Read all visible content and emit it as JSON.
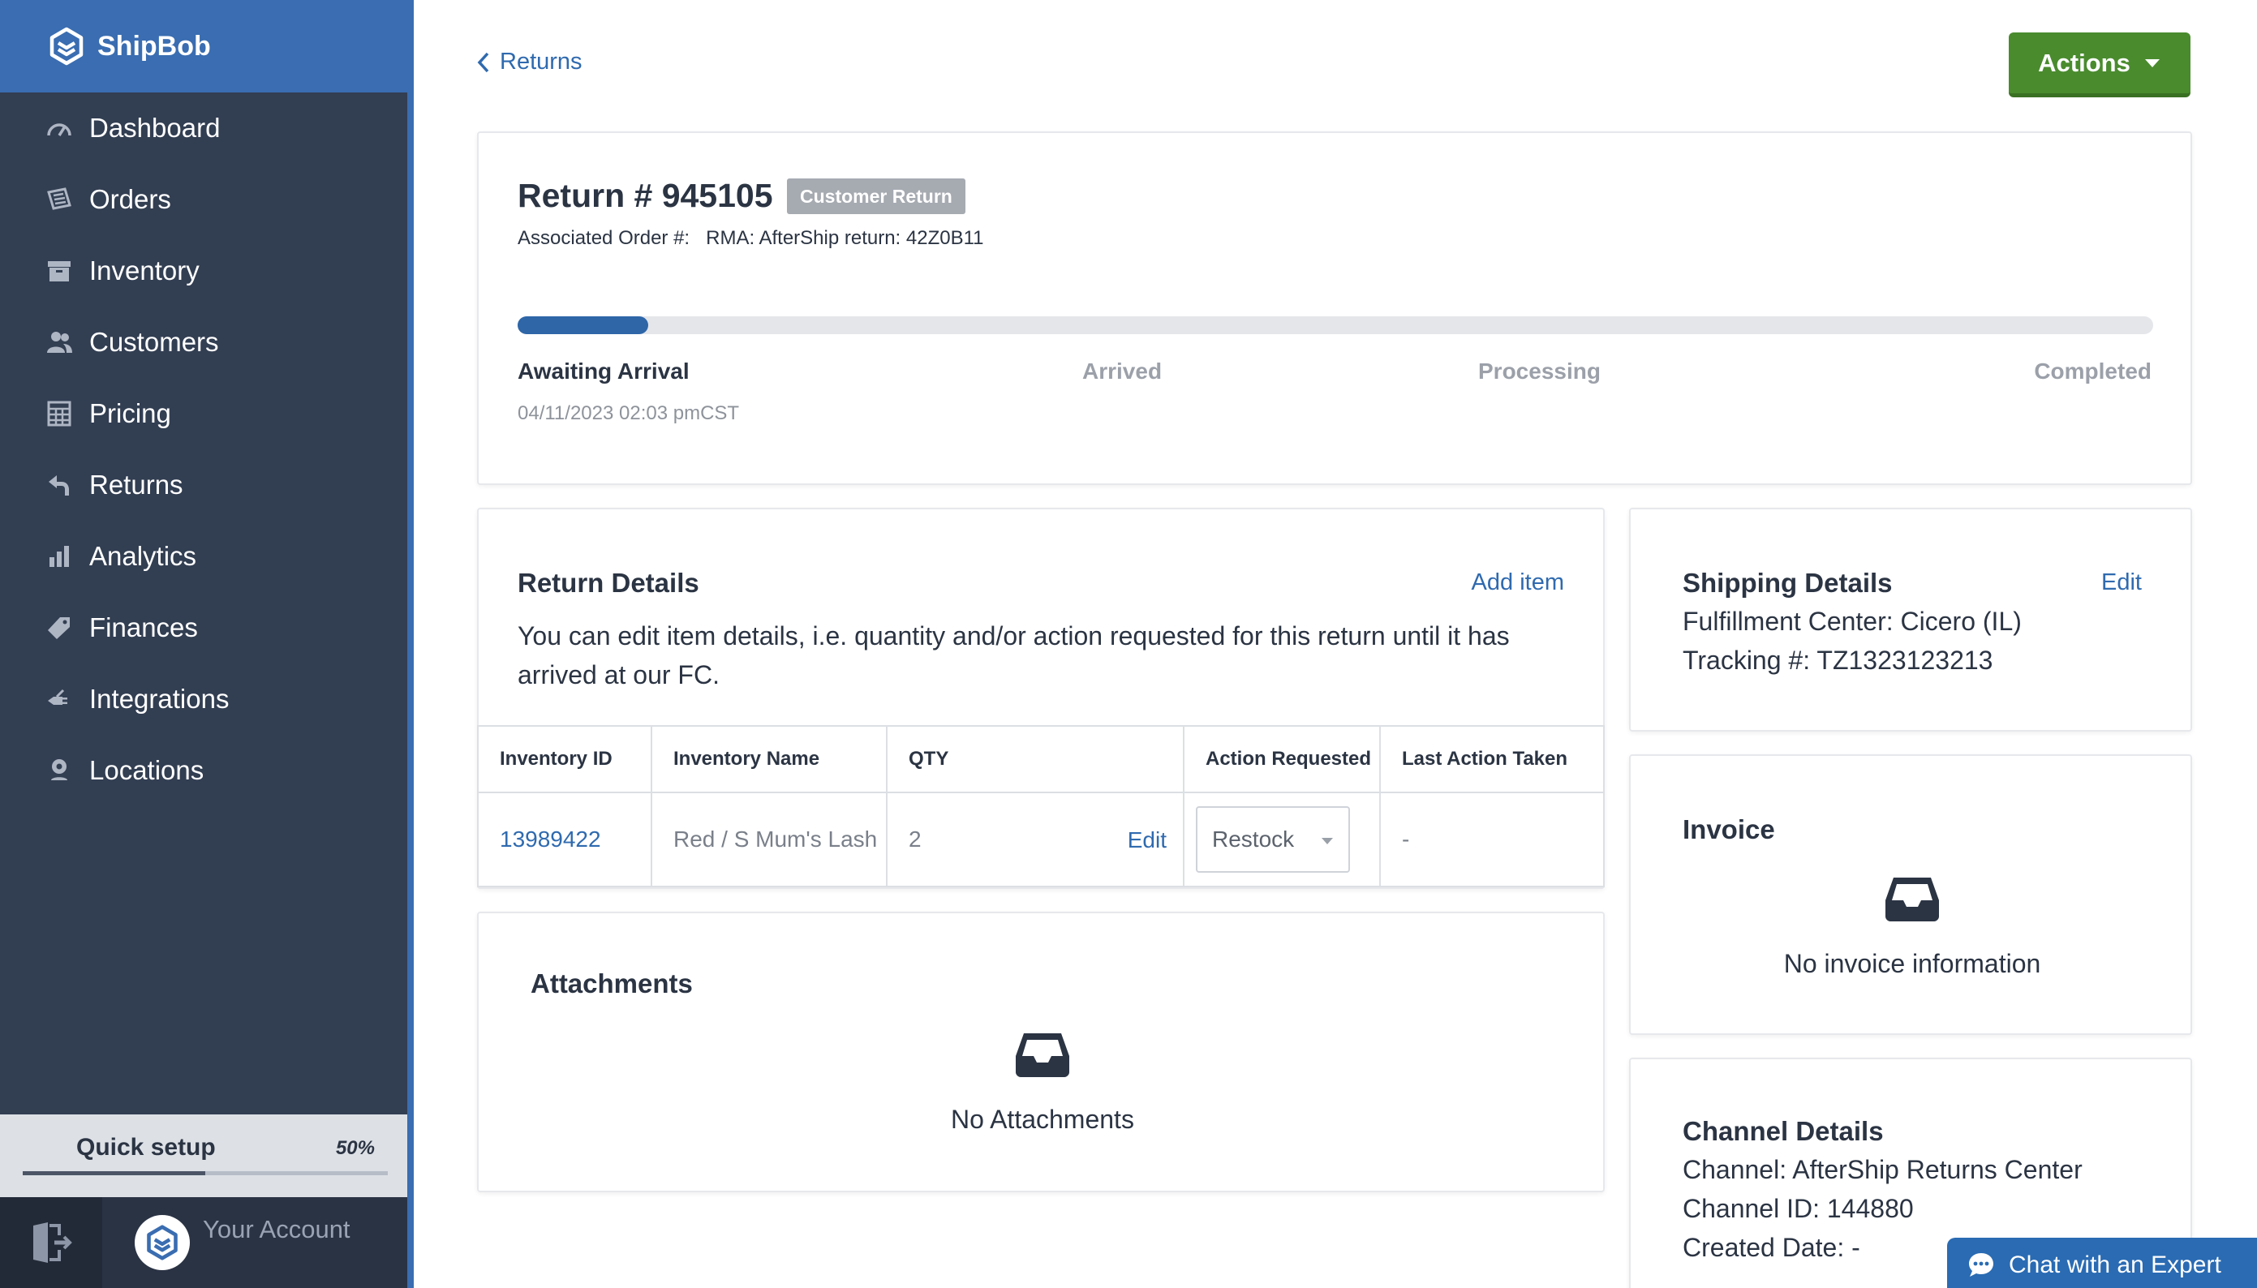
{
  "app": {
    "brand": "ShipBob"
  },
  "sidebar": {
    "items": [
      {
        "label": "Dashboard",
        "icon": "gauge-icon"
      },
      {
        "label": "Orders",
        "icon": "orders-icon"
      },
      {
        "label": "Inventory",
        "icon": "box-icon"
      },
      {
        "label": "Customers",
        "icon": "users-icon"
      },
      {
        "label": "Pricing",
        "icon": "calculator-icon"
      },
      {
        "label": "Returns",
        "icon": "return-arrow-icon"
      },
      {
        "label": "Analytics",
        "icon": "bar-chart-icon"
      },
      {
        "label": "Finances",
        "icon": "tag-icon"
      },
      {
        "label": "Integrations",
        "icon": "plug-icon"
      },
      {
        "label": "Locations",
        "icon": "location-pin-icon"
      }
    ],
    "quick_setup": {
      "label": "Quick setup",
      "percent_text": "50%",
      "progress": 0.5
    },
    "account": {
      "label": "Your Account"
    }
  },
  "header": {
    "back_label": "Returns",
    "actions_label": "Actions"
  },
  "return": {
    "title": "Return # 945105",
    "badge": "Customer Return",
    "associated_order_label": "Associated Order #:",
    "rma": "RMA: AfterShip return: 42Z0B11",
    "progress": 0.08,
    "steps": [
      "Awaiting Arrival",
      "Arrived",
      "Processing",
      "Completed"
    ],
    "step_date": "04/11/2023 02:03 pmCST"
  },
  "return_details": {
    "title": "Return Details",
    "add_item_label": "Add item",
    "description": "You can edit item details, i.e. quantity and/or action requested for this return until it has arrived at our FC.",
    "columns": [
      "Inventory ID",
      "Inventory Name",
      "QTY",
      "Action Requested",
      "Last Action Taken"
    ],
    "rows": [
      {
        "inventory_id": "13989422",
        "inventory_name": "Red / S Mum's Lash",
        "qty": "2",
        "edit_label": "Edit",
        "action_requested": "Restock",
        "last_action": "-"
      }
    ]
  },
  "attachments": {
    "title": "Attachments",
    "empty_text": "No Attachments"
  },
  "shipping": {
    "title": "Shipping Details",
    "edit_label": "Edit",
    "fulfillment_center": "Fulfillment Center: Cicero (IL)",
    "tracking": "Tracking #: TZ1323123213"
  },
  "invoice": {
    "title": "Invoice",
    "empty_text": "No invoice information"
  },
  "channel": {
    "title": "Channel Details",
    "channel": "Channel: AfterShip Returns Center",
    "channel_id": "Channel ID: 144880",
    "created_date": "Created Date: -"
  },
  "chat": {
    "label": "Chat with an Expert"
  },
  "colors": {
    "brand_blue": "#3a6db1",
    "sidebar_bg": "#323e52",
    "action_green": "#4a8b2e",
    "link_blue": "#2f6aaf"
  }
}
